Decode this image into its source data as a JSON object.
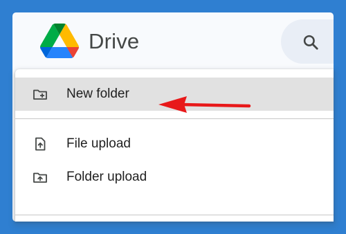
{
  "app": {
    "title": "Drive"
  },
  "colors": {
    "page_background": "#2f7fd1",
    "active_item": "#e1e1e1",
    "annotation_arrow": "#e8191a",
    "drive_green": "#0f9d58",
    "drive_yellow": "#f4b400",
    "drive_blue": "#4285f4",
    "drive_red": "#db4437"
  },
  "header": {
    "search_icon": "search-icon"
  },
  "menu": {
    "items": [
      {
        "label": "New folder",
        "icon": "new-folder-icon",
        "active": true
      },
      {
        "label": "File upload",
        "icon": "file-upload-icon",
        "active": false
      },
      {
        "label": "Folder upload",
        "icon": "folder-upload-icon",
        "active": false
      }
    ]
  }
}
